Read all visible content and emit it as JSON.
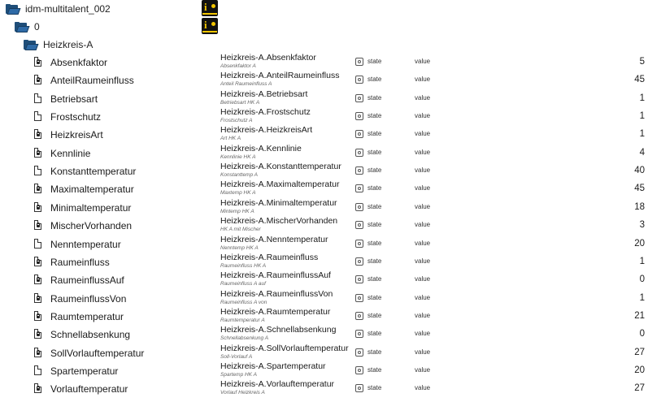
{
  "tree": {
    "root": "idm-multitalent_002",
    "instance": "0",
    "channel": "Heizkreis-A"
  },
  "states": [
    {
      "name": "Absenkfaktor",
      "id": "Heizkreis-A.Absenkfaktor",
      "desc": "Absenkfaktor A",
      "role": "state",
      "type": "value",
      "value": "5",
      "locked": true
    },
    {
      "name": "AnteilRaumeinfluss",
      "id": "Heizkreis-A.AnteilRaumeinfluss",
      "desc": "Anteil Raumeinfluss A",
      "role": "state",
      "type": "value",
      "value": "45",
      "locked": true
    },
    {
      "name": "Betriebsart",
      "id": "Heizkreis-A.Betriebsart",
      "desc": "Betriebsart HK A",
      "role": "state",
      "type": "value",
      "value": "1",
      "locked": false
    },
    {
      "name": "Frostschutz",
      "id": "Heizkreis-A.Frostschutz",
      "desc": "Frostschutz A",
      "role": "state",
      "type": "value",
      "value": "1",
      "locked": false
    },
    {
      "name": "HeizkreisArt",
      "id": "Heizkreis-A.HeizkreisArt",
      "desc": "Art HK A",
      "role": "state",
      "type": "value",
      "value": "1",
      "locked": true
    },
    {
      "name": "Kennlinie",
      "id": "Heizkreis-A.Kennlinie",
      "desc": "Kennlinie HK A",
      "role": "state",
      "type": "value",
      "value": "4",
      "locked": true
    },
    {
      "name": "Konstanttemperatur",
      "id": "Heizkreis-A.Konstanttemperatur",
      "desc": "Konstanttemp A",
      "role": "state",
      "type": "value",
      "value": "40",
      "locked": false
    },
    {
      "name": "Maximaltemperatur",
      "id": "Heizkreis-A.Maximaltemperatur",
      "desc": "Maxtemp HK A",
      "role": "state",
      "type": "value",
      "value": "45",
      "locked": true
    },
    {
      "name": "Minimaltemperatur",
      "id": "Heizkreis-A.Minimaltemperatur",
      "desc": "Mintemp HK A",
      "role": "state",
      "type": "value",
      "value": "18",
      "locked": true
    },
    {
      "name": "MischerVorhanden",
      "id": "Heizkreis-A.MischerVorhanden",
      "desc": "HK A mit Mischer",
      "role": "state",
      "type": "value",
      "value": "3",
      "locked": true
    },
    {
      "name": "Nenntemperatur",
      "id": "Heizkreis-A.Nenntemperatur",
      "desc": "Nenntemp HK A",
      "role": "state",
      "type": "value",
      "value": "20",
      "locked": false
    },
    {
      "name": "Raumeinfluss",
      "id": "Heizkreis-A.Raumeinfluss",
      "desc": "Raumeinfluss HK A",
      "role": "state",
      "type": "value",
      "value": "1",
      "locked": true
    },
    {
      "name": "RaumeinflussAuf",
      "id": "Heizkreis-A.RaumeinflussAuf",
      "desc": "Raumeinfluss A auf",
      "role": "state",
      "type": "value",
      "value": "0",
      "locked": true
    },
    {
      "name": "RaumeinflussVon",
      "id": "Heizkreis-A.RaumeinflussVon",
      "desc": "Raumeinfluss A von",
      "role": "state",
      "type": "value",
      "value": "1",
      "locked": true
    },
    {
      "name": "Raumtemperatur",
      "id": "Heizkreis-A.Raumtemperatur",
      "desc": "Raumtemperatur A",
      "role": "state",
      "type": "value",
      "value": "21",
      "locked": true
    },
    {
      "name": "Schnellabsenkung",
      "id": "Heizkreis-A.Schnellabsenkung",
      "desc": "Schnellabsenkung A",
      "role": "state",
      "type": "value",
      "value": "0",
      "locked": true
    },
    {
      "name": "SollVorlauftemperatur",
      "id": "Heizkreis-A.SollVorlauftemperatur",
      "desc": "Soll-Vorlauf A",
      "role": "state",
      "type": "value",
      "value": "27",
      "locked": true
    },
    {
      "name": "Spartemperatur",
      "id": "Heizkreis-A.Spartemperatur",
      "desc": "Spartemp HK A",
      "role": "state",
      "type": "value",
      "value": "20",
      "locked": false
    },
    {
      "name": "Vorlauftemperatur",
      "id": "Heizkreis-A.Vorlauftemperatur",
      "desc": "Vorlauf Heizkreis A",
      "role": "state",
      "type": "value",
      "value": "27",
      "locked": true
    }
  ],
  "icons": {
    "folder": "folder-open-icon",
    "file": "file-icon",
    "locked_file": "locked-file-icon",
    "adapter_logo": "idm-logo-icon",
    "role": "role-state-icon"
  },
  "colors": {
    "folder": "#1f4e79",
    "logo_bg": "#111111",
    "logo_fg": "#f2c500"
  }
}
